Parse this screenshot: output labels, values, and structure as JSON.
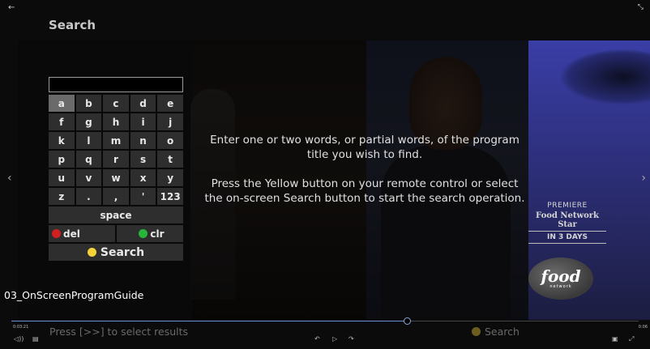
{
  "header": {
    "title": "Search",
    "back_icon": "←",
    "expand_icon": "⤡"
  },
  "keyboard": {
    "search_value": "",
    "rows": [
      [
        "a",
        "b",
        "c",
        "d",
        "e"
      ],
      [
        "f",
        "g",
        "h",
        "i",
        "j"
      ],
      [
        "k",
        "l",
        "m",
        "n",
        "o"
      ],
      [
        "p",
        "q",
        "r",
        "s",
        "t"
      ],
      [
        "u",
        "v",
        "w",
        "x",
        "y"
      ],
      [
        "z",
        ".",
        ",",
        "'",
        "123"
      ]
    ],
    "selected_key": "a",
    "space_label": "space",
    "del_label": "del",
    "clr_label": "clr",
    "search_label": "Search"
  },
  "instructions": {
    "line1": "Enter one or two words, or partial words, of the program title you wish to find.",
    "line2": "Press the Yellow button on your remote control or select the on-screen Search button to start the search operation."
  },
  "promo": {
    "premiere": "PREMIERE",
    "show": "Food Network Star",
    "days": "IN 3 DAYS",
    "logo_main": "food",
    "logo_sub": "network"
  },
  "caption": "03_OnScreenProgramGuide",
  "footer": {
    "hint": "Press [>>] to select results",
    "search_label": "Search",
    "time_left": "0:03:21",
    "time_right": "0:06",
    "progress_percent": 63
  },
  "icons": {
    "prev": "‹",
    "next": "›",
    "volume": "◁))",
    "subtitles": "▤",
    "rewind": "↶",
    "play": "▷",
    "forward": "↷",
    "pip": "▣",
    "fullscreen": "⤢"
  },
  "colors": {
    "red": "#d21f1f",
    "green": "#27b53a",
    "yellow": "#f3d23a",
    "progress": "#6d8fd6"
  }
}
